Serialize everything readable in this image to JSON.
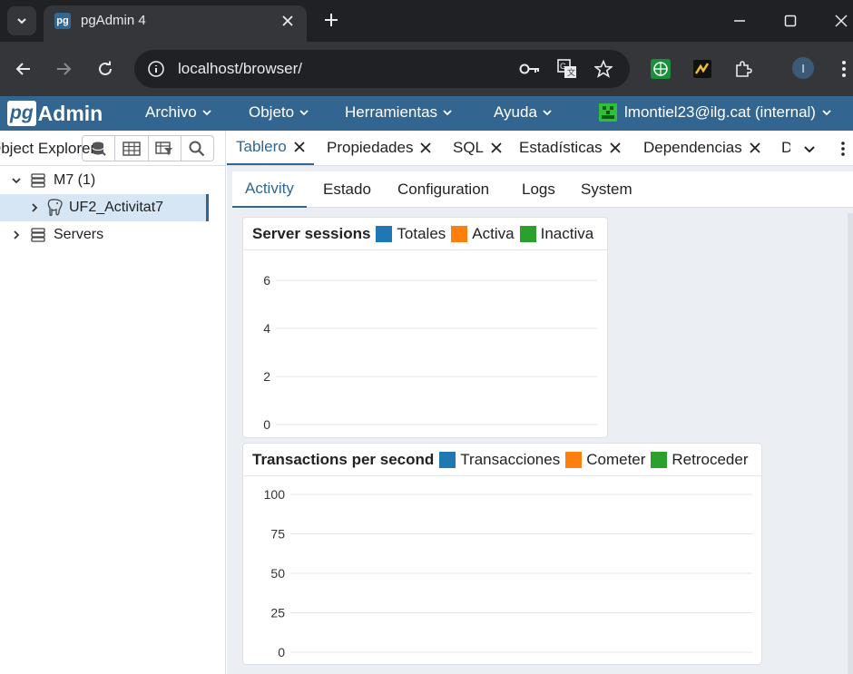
{
  "browser": {
    "tab_title": "pgAdmin 4",
    "favicon_text": "pg",
    "url": "localhost/browser/",
    "profile_initial": "I"
  },
  "header": {
    "logo_pg": "pg",
    "logo_admin": "Admin",
    "menus": [
      "Archivo",
      "Objeto",
      "Herramientas",
      "Ayuda"
    ],
    "user": "lmontiel23@ilg.cat (internal)"
  },
  "explorer": {
    "title": "Object Explorer",
    "tree": [
      {
        "label": "M7 (1)",
        "expanded": true,
        "icon": "server-group-icon"
      },
      {
        "label": "UF2_Activitat7",
        "expanded": false,
        "icon": "postgres-elephant-icon",
        "selected": true
      },
      {
        "label": "Servers",
        "expanded": false,
        "icon": "server-group-icon"
      }
    ]
  },
  "main_tabs": [
    "Tablero",
    "Propiedades",
    "SQL",
    "Estadísticas",
    "Dependencias",
    "D"
  ],
  "sub_tabs": [
    "Activity",
    "Estado",
    "Configuration",
    "Logs",
    "System"
  ],
  "colors": {
    "accent": "#326690",
    "series_blue": "#1f77b4",
    "series_orange": "#ff7f0e",
    "series_green": "#2ca02c"
  },
  "chart_data": [
    {
      "type": "line",
      "title": "Server sessions",
      "series": [
        {
          "name": "Totales",
          "color": "#1f77b4",
          "values": []
        },
        {
          "name": "Activa",
          "color": "#ff7f0e",
          "values": []
        },
        {
          "name": "Inactiva",
          "color": "#2ca02c",
          "values": []
        }
      ],
      "y_ticks": [
        0,
        2,
        4,
        6
      ],
      "ylim": [
        0,
        6.5
      ],
      "grid": true,
      "legend": "top"
    },
    {
      "type": "line",
      "title": "Transactions per second",
      "series": [
        {
          "name": "Transacciones",
          "color": "#1f77b4",
          "values": []
        },
        {
          "name": "Cometer",
          "color": "#ff7f0e",
          "values": []
        },
        {
          "name": "Retroceder",
          "color": "#2ca02c",
          "values": []
        }
      ],
      "y_ticks": [
        0,
        25,
        50,
        75,
        100
      ],
      "ylim": [
        0,
        100
      ],
      "grid": true,
      "legend": "top"
    }
  ]
}
